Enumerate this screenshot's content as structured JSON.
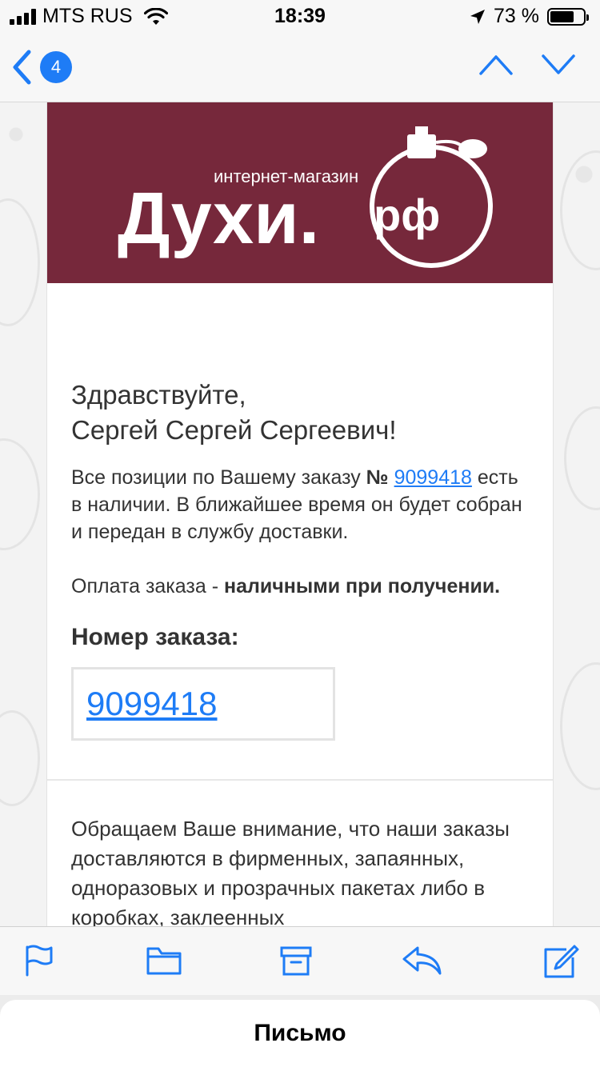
{
  "status_bar": {
    "carrier": "MTS RUS",
    "time": "18:39",
    "battery": "73 %",
    "battery_level": 0.73
  },
  "nav": {
    "back_count": "4"
  },
  "email": {
    "logo": {
      "top_text": "интернет-магазин",
      "main_text": "Духи.",
      "suffix": "рф"
    },
    "greeting_line1": "Здравствуйте,",
    "greeting_line2": "Сергей Сергей Сергеевич!",
    "availability_pre": "Все позиции по Вашему заказу ",
    "availability_num_sign": "№",
    "order_number": "9099418",
    "availability_post": " есть в наличии. В ближайшее время он будет собран и передан в службу доставки.",
    "payment_pre": "Оплата заказа - ",
    "payment_method": "наличными при получении.",
    "order_heading": "Номер заказа:",
    "notice": "Обращаем Ваше внимание, что наши заказы доставляются в фирменных, запаянных, одноразовых и прозрачных пакетах либо в коробках, заклеенных"
  },
  "toolbar": {
    "icons": [
      "flag-icon",
      "folder-icon",
      "archive-icon",
      "reply-icon",
      "compose-icon"
    ]
  },
  "sheet": {
    "title": "Письмо"
  },
  "colors": {
    "accent": "#1e7cf6",
    "banner": "#76283b"
  }
}
